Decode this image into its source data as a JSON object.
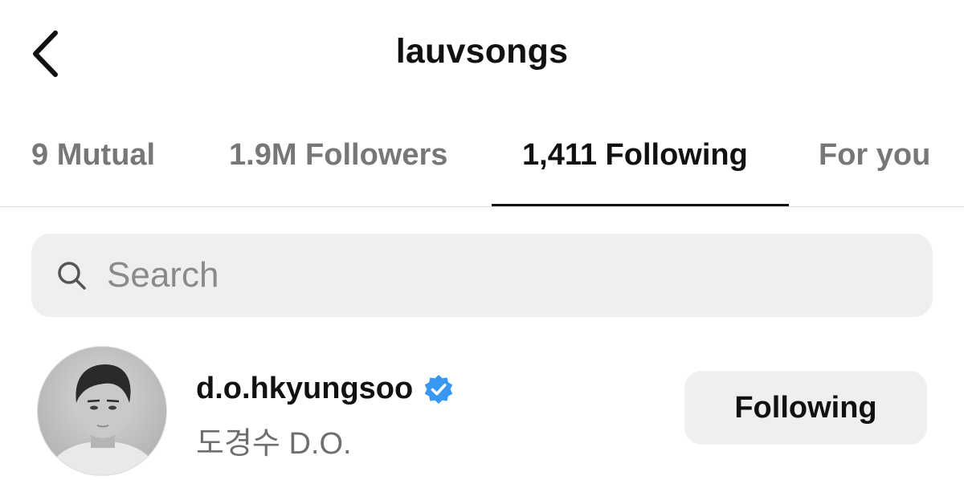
{
  "header": {
    "title": "lauvsongs",
    "back_icon": "chevron-left-icon"
  },
  "tabs": [
    {
      "label": "9 Mutual",
      "active": false
    },
    {
      "label": "1.9M Followers",
      "active": false
    },
    {
      "label": "1,411 Following",
      "active": true
    },
    {
      "label": "For you",
      "active": false
    }
  ],
  "search": {
    "placeholder": "Search",
    "value": "",
    "icon": "search-icon"
  },
  "list": [
    {
      "username": "d.o.hkyungsoo",
      "verified": true,
      "full_name": "도경수 D.O.",
      "button_label": "Following"
    }
  ],
  "colors": {
    "text_primary": "#111111",
    "text_secondary": "#777777",
    "search_bg": "#efefef",
    "button_bg": "#efefef",
    "verified_blue": "#3897f0",
    "divider": "#dcdcdc"
  }
}
